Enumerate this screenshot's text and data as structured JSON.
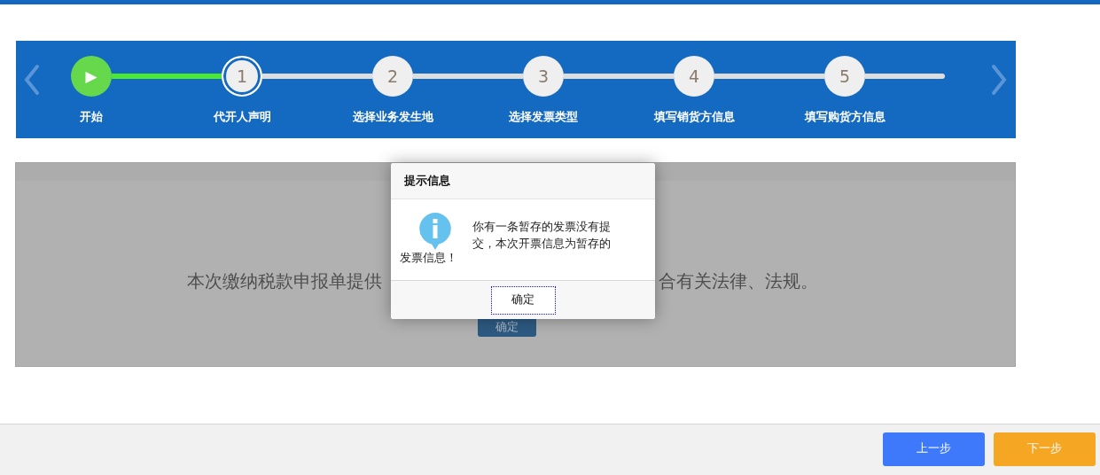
{
  "stepper": {
    "steps": [
      {
        "marker": "▶",
        "label": "开始",
        "done": true,
        "current": false
      },
      {
        "marker": "1",
        "label": "代开人声明",
        "done": false,
        "current": true
      },
      {
        "marker": "2",
        "label": "选择业务发生地",
        "done": false,
        "current": false
      },
      {
        "marker": "3",
        "label": "选择发票类型",
        "done": false,
        "current": false
      },
      {
        "marker": "4",
        "label": "填写销货方信息",
        "done": false,
        "current": false
      },
      {
        "marker": "5",
        "label": "填写购货方信息",
        "done": false,
        "current": false
      }
    ]
  },
  "content": {
    "text_left": "本次缴纳税款申报单提供",
    "text_right": "合有关法律、法规。",
    "button": "确定"
  },
  "dialog": {
    "title": "提示信息",
    "message": "你有一条暂存的发票没有提交，本次开票信息为暂存的",
    "message_tail": "发票信息！",
    "button": "确定"
  },
  "footer": {
    "buttons": [
      {
        "label": "上一步",
        "kind": "prev"
      },
      {
        "label": "下一步",
        "kind": "next"
      }
    ]
  }
}
